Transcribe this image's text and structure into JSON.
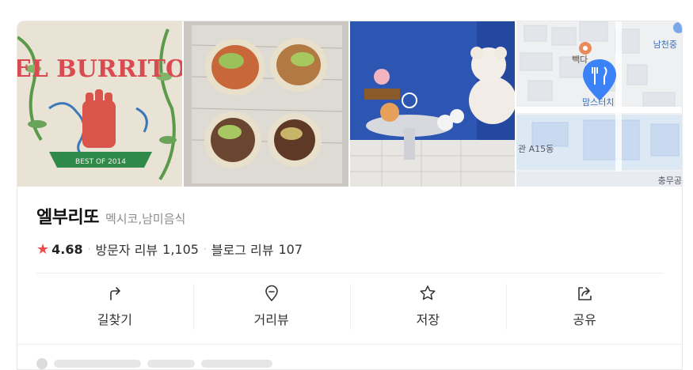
{
  "place": {
    "name": "엘부리또",
    "category": "멕시코,남미음식",
    "rating": "4.68",
    "visitor_review_label": "방문자 리뷰",
    "visitor_review_count": "1,105",
    "blog_review_label": "블로그 리뷰",
    "blog_review_count": "107"
  },
  "photos": [
    {
      "name": "logo-photo",
      "sign_text": "EL BURRITO",
      "sign_sub": "BEST OF 2014"
    },
    {
      "name": "burrito-photo"
    },
    {
      "name": "interior-photo"
    },
    {
      "name": "map-thumbnail"
    }
  ],
  "map": {
    "labels": {
      "top_right": "남천중",
      "cafe": "빽다",
      "store": "맘스터치",
      "building": "관 A15동",
      "bottom_right": "충무공"
    }
  },
  "actions": [
    {
      "label": "길찾기",
      "icon": "directions-icon"
    },
    {
      "label": "거리뷰",
      "icon": "streetview-pin-icon"
    },
    {
      "label": "저장",
      "icon": "star-save-icon"
    },
    {
      "label": "공유",
      "icon": "share-icon"
    }
  ],
  "colors": {
    "star": "#ef4b4b",
    "map_pin": "#3b82f6"
  }
}
